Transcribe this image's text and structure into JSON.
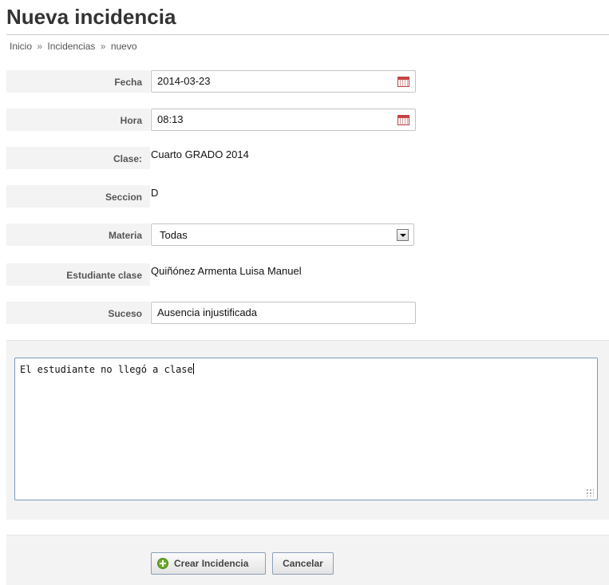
{
  "page": {
    "title": "Nueva incidencia"
  },
  "breadcrumb": {
    "items": [
      "Inicio",
      "Incidencias",
      "nuevo"
    ],
    "separator": "»"
  },
  "form": {
    "fecha": {
      "label": "Fecha",
      "value": "2014-03-23",
      "icon": "calendar-icon"
    },
    "hora": {
      "label": "Hora",
      "value": "08:13",
      "icon": "calendar-icon"
    },
    "clase": {
      "label": "Clase:",
      "value": "Cuarto GRADO 2014"
    },
    "seccion": {
      "label": "Seccion",
      "value": "D"
    },
    "materia": {
      "label": "Materia",
      "selected": "Todas",
      "icon": "chevron-down-icon"
    },
    "estudiante": {
      "label": "Estudiante clase",
      "value": "Quiñónez Armenta Luisa Manuel"
    },
    "suceso": {
      "label": "Suceso",
      "value": "Ausencia injustificada"
    },
    "descripcion": {
      "value": "El estudiante no llegó a clase"
    }
  },
  "actions": {
    "create_label": "Crear Incidencia",
    "create_icon": "plus-circle-icon",
    "cancel_label": "Cancelar"
  }
}
